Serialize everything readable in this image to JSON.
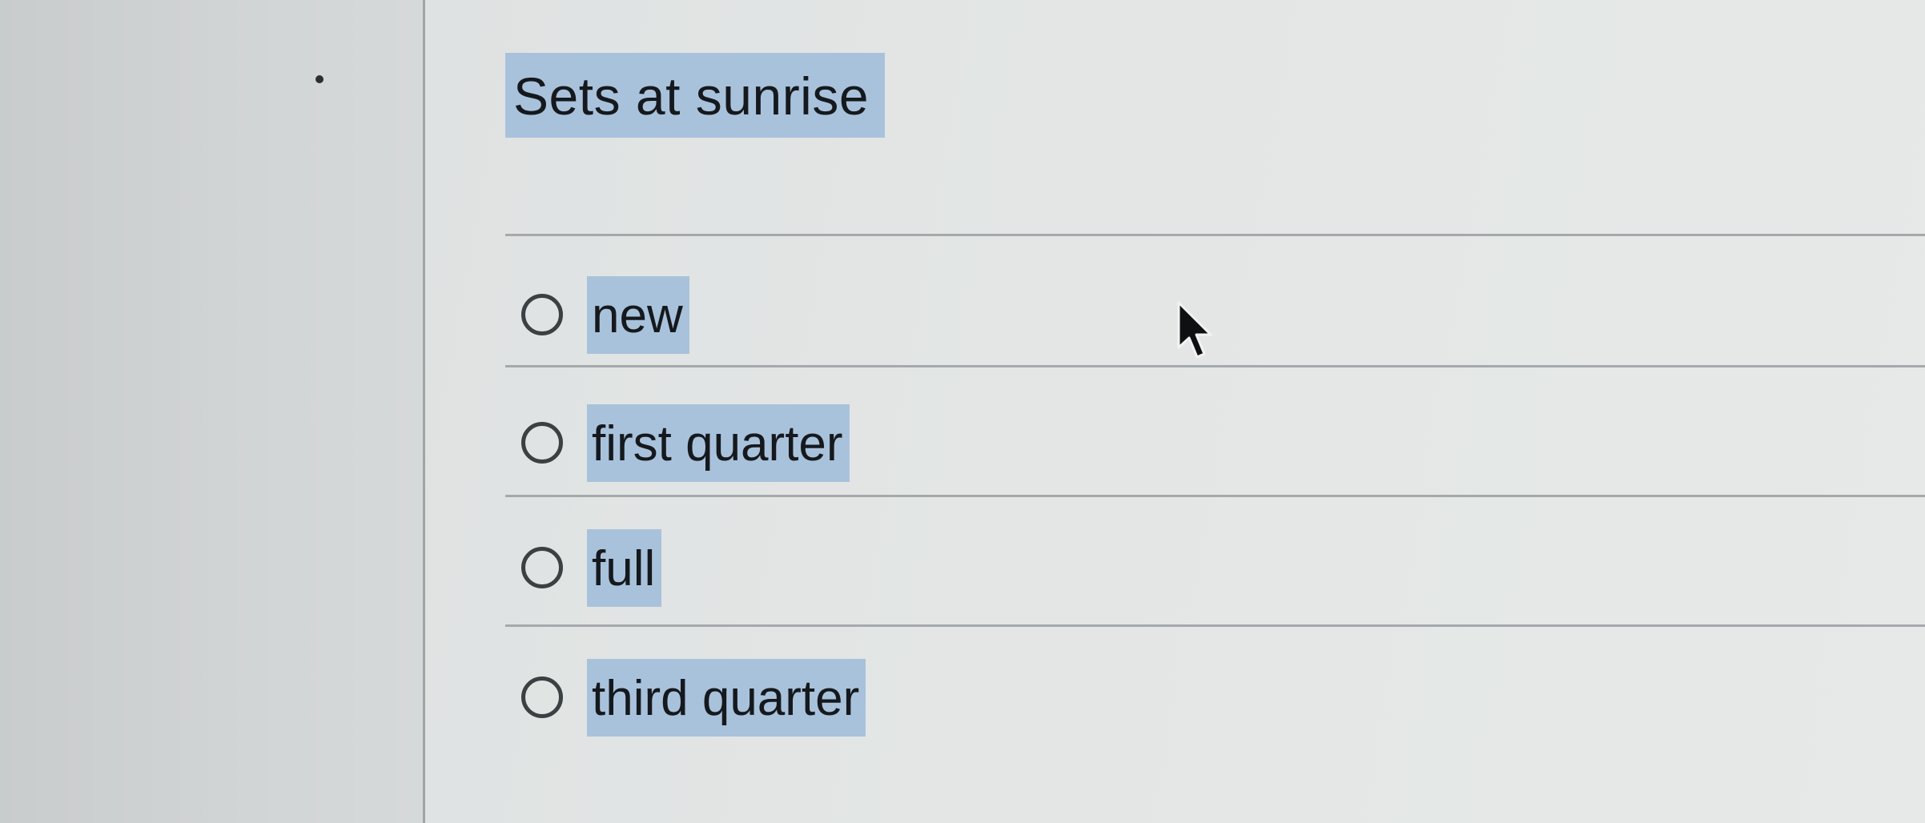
{
  "question": {
    "text": "Sets at sunrise"
  },
  "options": [
    {
      "label": "new"
    },
    {
      "label": "first quarter"
    },
    {
      "label": "full"
    },
    {
      "label": "third quarter"
    }
  ],
  "colors": {
    "highlight": "#a9c2dc",
    "panel": "#e3e6e5",
    "text": "#15191d"
  },
  "icons": {
    "radio": "radio-unchecked-icon",
    "cursor": "mouse-pointer-icon"
  }
}
